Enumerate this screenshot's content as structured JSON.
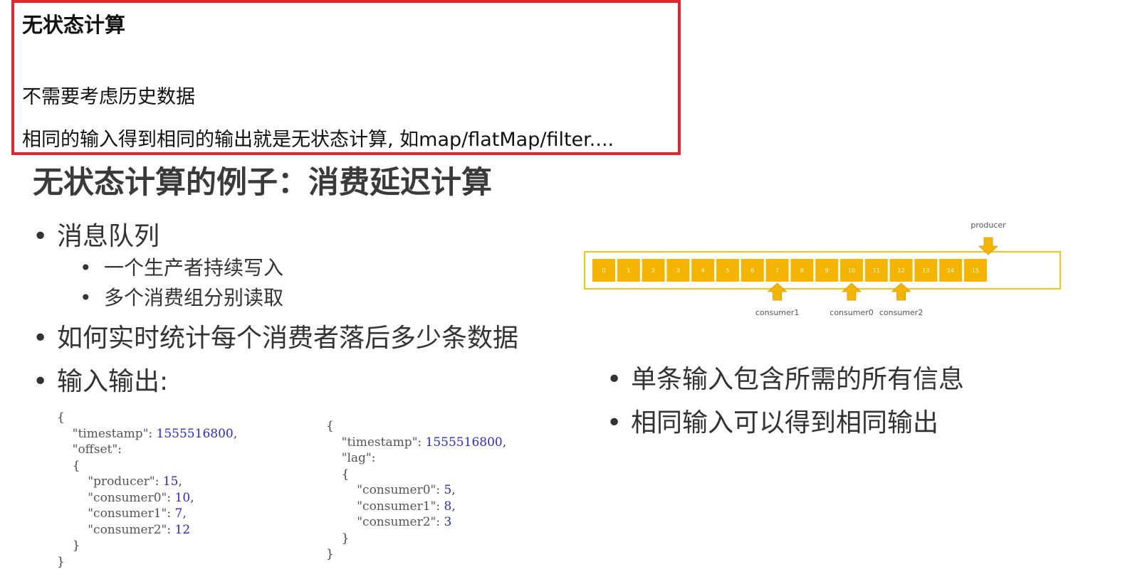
{
  "note": {
    "title": "无状态计算",
    "line1": "不需要考虑历史数据",
    "line2": "相同的输入得到相同的输出就是无状态计算, 如map/flatMap/filter...."
  },
  "slide": {
    "title": "无状态计算的例子：消费延迟计算",
    "bullets": {
      "mq": "消息队列",
      "mq_sub1": "一个生产者持续写入",
      "mq_sub2": "多个消费组分别读取",
      "how": "如何实时统计每个消费者落后多少条数据",
      "io": "输入输出:",
      "single": "单条输入包含所需的所有信息",
      "same": "相同输入可以得到相同输出"
    },
    "bullet_char": "•"
  },
  "input_json": {
    "open": "{",
    "ts_key": "\"timestamp\"",
    "ts_val": "1555516800",
    "offset_key": "\"offset\"",
    "inner_open": "{",
    "rows": [
      {
        "key": "\"producer\"",
        "val": "15"
      },
      {
        "key": "\"consumer0\"",
        "val": "10"
      },
      {
        "key": "\"consumer1\"",
        "val": "7"
      },
      {
        "key": "\"consumer2\"",
        "val": "12"
      }
    ],
    "inner_close": "}",
    "close": "}"
  },
  "output_json": {
    "open": "{",
    "ts_key": "\"timestamp\"",
    "ts_val": "1555516800",
    "lag_key": "\"lag\"",
    "inner_open": "{",
    "rows": [
      {
        "key": "\"consumer0\"",
        "val": "5"
      },
      {
        "key": "\"consumer1\"",
        "val": "8"
      },
      {
        "key": "\"consumer2\"",
        "val": "3"
      }
    ],
    "inner_close": "}",
    "close": "}"
  },
  "diagram": {
    "cells": [
      "0",
      "1",
      "2",
      "3",
      "4",
      "5",
      "6",
      "7",
      "8",
      "9",
      "10",
      "11",
      "12",
      "13",
      "14",
      "15"
    ],
    "producer_label": "producer",
    "producer_cell": 15,
    "consumers": [
      {
        "label": "consumer1",
        "cell": 7
      },
      {
        "label": "consumer0",
        "cell": 10
      },
      {
        "label": "consumer2",
        "cell": 12
      }
    ],
    "colors": {
      "cell": "#f5b400",
      "frame": "#f5c518",
      "arrow": "#f5b400",
      "label": "#555555"
    }
  }
}
